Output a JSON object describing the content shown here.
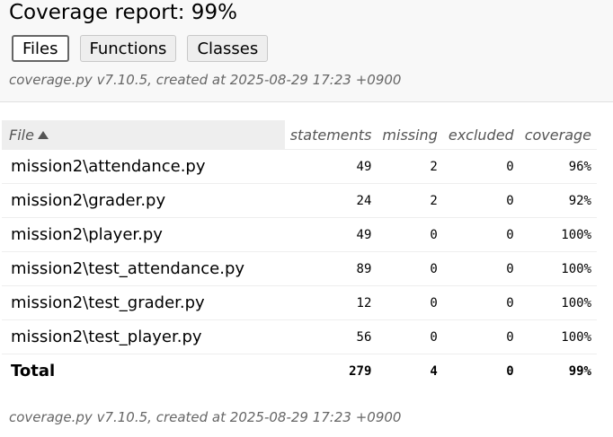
{
  "title": "Coverage report: 99%",
  "tabs": [
    {
      "label": "Files",
      "active": true
    },
    {
      "label": "Functions",
      "active": false
    },
    {
      "label": "Classes",
      "active": false
    }
  ],
  "created_text": "coverage.py v7.10.5, created at 2025-08-29 17:23 +0900",
  "table": {
    "columns": [
      "File",
      "statements",
      "missing",
      "excluded",
      "coverage"
    ],
    "sort": {
      "column": "File",
      "direction": "ascending"
    },
    "rows": [
      {
        "file": "mission2\\attendance.py",
        "statements": "49",
        "missing": "2",
        "excluded": "0",
        "coverage": "96%"
      },
      {
        "file": "mission2\\grader.py",
        "statements": "24",
        "missing": "2",
        "excluded": "0",
        "coverage": "92%"
      },
      {
        "file": "mission2\\player.py",
        "statements": "49",
        "missing": "0",
        "excluded": "0",
        "coverage": "100%"
      },
      {
        "file": "mission2\\test_attendance.py",
        "statements": "89",
        "missing": "0",
        "excluded": "0",
        "coverage": "100%"
      },
      {
        "file": "mission2\\test_grader.py",
        "statements": "12",
        "missing": "0",
        "excluded": "0",
        "coverage": "100%"
      },
      {
        "file": "mission2\\test_player.py",
        "statements": "56",
        "missing": "0",
        "excluded": "0",
        "coverage": "100%"
      }
    ],
    "total": {
      "label": "Total",
      "statements": "279",
      "missing": "4",
      "excluded": "0",
      "coverage": "99%"
    }
  }
}
